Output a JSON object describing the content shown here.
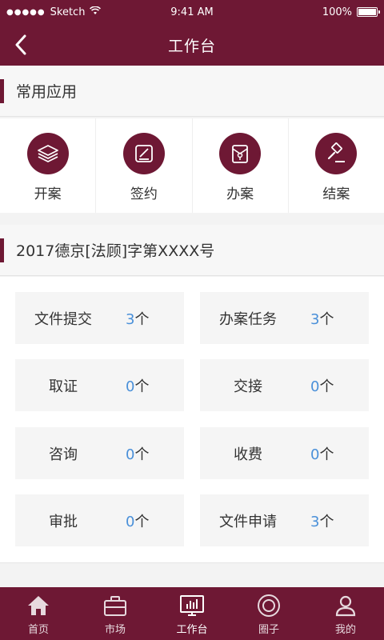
{
  "status_bar": {
    "carrier": "Sketch",
    "signal_dots": "●●●●●",
    "time": "9:41 AM",
    "battery": "100%"
  },
  "nav": {
    "title": "工作台",
    "back_icon": "chevron-left-icon"
  },
  "common_apps": {
    "title": "常用应用",
    "items": [
      {
        "label": "开案",
        "icon": "layers-icon"
      },
      {
        "label": "签约",
        "icon": "sign-icon"
      },
      {
        "label": "办案",
        "icon": "case-folder-icon"
      },
      {
        "label": "结案",
        "icon": "gavel-icon"
      }
    ]
  },
  "case": {
    "title": "2017德京[法顾]字第XXXX号",
    "stats": [
      {
        "name": "文件提交",
        "value": "3",
        "unit": "个"
      },
      {
        "name": "办案任务",
        "value": "3",
        "unit": "个"
      },
      {
        "name": "取证",
        "value": "0",
        "unit": "个"
      },
      {
        "name": "交接",
        "value": "0",
        "unit": "个"
      },
      {
        "name": "咨询",
        "value": "0",
        "unit": "个"
      },
      {
        "name": "收费",
        "value": "0",
        "unit": "个"
      },
      {
        "name": "审批",
        "value": "0",
        "unit": "个"
      },
      {
        "name": "文件申请",
        "value": "3",
        "unit": "个"
      }
    ]
  },
  "tabs": [
    {
      "label": "首页",
      "icon": "home-icon",
      "active": false
    },
    {
      "label": "市场",
      "icon": "briefcase-icon",
      "active": false
    },
    {
      "label": "工作台",
      "icon": "dashboard-icon",
      "active": true
    },
    {
      "label": "圈子",
      "icon": "circle-icon",
      "active": false
    },
    {
      "label": "我的",
      "icon": "user-icon",
      "active": false
    }
  ],
  "colors": {
    "brand": "#6e1834",
    "number": "#4a90d9"
  }
}
